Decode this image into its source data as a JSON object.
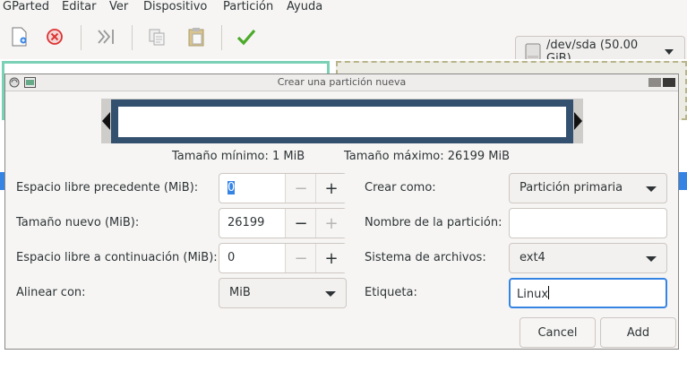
{
  "menubar": {
    "items": [
      "GParted",
      "Editar",
      "Ver",
      "Dispositivo",
      "Partición",
      "Ayuda"
    ]
  },
  "toolbar": {
    "icons": [
      "new-icon",
      "delete-icon",
      "resize-move-icon",
      "copy-icon",
      "paste-icon",
      "apply-icon"
    ],
    "device": "/dev/sda (50.00 GiB)"
  },
  "dialog": {
    "title": "Crear una partición nueva",
    "min_size": "Tamaño mínimo: 1 MiB",
    "max_size": "Tamaño máximo: 26199 MiB",
    "free_before": {
      "label": "Espacio libre precedente (MiB):",
      "value": "0"
    },
    "new_size": {
      "label": "Tamaño nuevo (MiB):",
      "value": "26199"
    },
    "free_after": {
      "label": "Espacio libre a continuación (MiB):",
      "value": "0"
    },
    "align": {
      "label": "Alinear con:",
      "value": "MiB"
    },
    "create_as": {
      "label": "Crear como:",
      "value": "Partición primaria"
    },
    "partition_name": {
      "label": "Nombre de la partición:",
      "value": ""
    },
    "filesystem": {
      "label": "Sistema de archivos:",
      "value": "ext4"
    },
    "fs_label": {
      "label": "Etiqueta:",
      "value": "Linux"
    },
    "minus": "−",
    "plus": "+",
    "cancel": "Cancel",
    "add": "Add"
  },
  "colors": {
    "accent": "#3584e4",
    "partition_map": "#34506f",
    "partition_border": "#7bd1b5"
  }
}
